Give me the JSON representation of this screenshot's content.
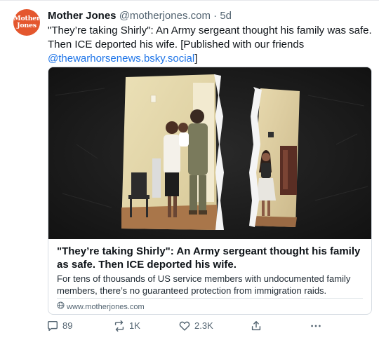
{
  "post": {
    "avatar_line1": "Mother",
    "avatar_line2": "Jones",
    "author_name": "Mother Jones",
    "author_handle": "@motherjones.com",
    "separator": " · ",
    "time": "5d",
    "text_main": "\"They’re taking Shirly\": An Army sergeant thought his family was safe. Then ICE deported his wife. [Published with our friends ",
    "mention": "@thewarhorsenews.bsky.social",
    "text_end": "]"
  },
  "card": {
    "title": "\"They’re taking Shirly\": An Army sergeant thought his family as safe. Then ICE deported his wife.",
    "description": "For tens of thousands of US service members with undocumented family members, there’s no guaranteed protection from immigration raids.",
    "source": "www.motherjones.com"
  },
  "actions": {
    "replies": "89",
    "reposts": "1K",
    "likes": "2.3K"
  },
  "colors": {
    "avatar_bg": "#e4572e",
    "link": "#1d74e8",
    "muted": "#536471"
  },
  "icons": [
    "reply-icon",
    "repost-icon",
    "like-icon",
    "share-icon",
    "more-icon",
    "globe-icon"
  ]
}
